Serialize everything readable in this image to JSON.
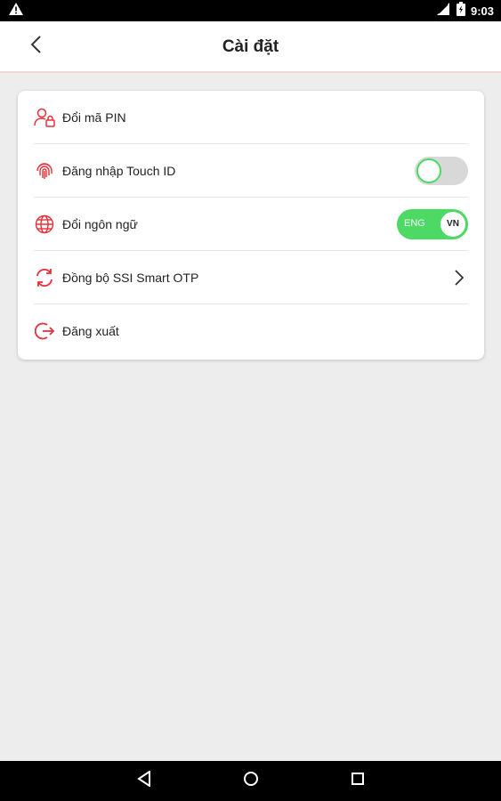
{
  "status_bar": {
    "time": "9:03",
    "icons": [
      "warning-icon",
      "signal-icon",
      "battery-icon"
    ]
  },
  "header": {
    "title": "Cài đặt",
    "back_icon": "chevron-left-icon"
  },
  "settings": {
    "items": [
      {
        "label": "Đổi mã PIN",
        "icon": "user-lock-icon"
      },
      {
        "label": "Đăng nhập Touch ID",
        "icon": "fingerprint-icon",
        "toggle": "off"
      },
      {
        "label": "Đổi ngôn ngữ",
        "icon": "globe-icon",
        "toggle_left": "ENG",
        "toggle_right": "VN"
      },
      {
        "label": "Đồng bộ SSI Smart OTP",
        "icon": "sync-icon",
        "trailing": "chevron-right-icon"
      },
      {
        "label": "Đăng xuất",
        "icon": "logout-icon"
      }
    ]
  },
  "colors": {
    "accent": "#e8303a",
    "toggle_on": "#4cd964",
    "background": "#ededed"
  },
  "nav_bar": {
    "icons": [
      "back-triangle-icon",
      "home-circle-icon",
      "recents-square-icon"
    ]
  }
}
